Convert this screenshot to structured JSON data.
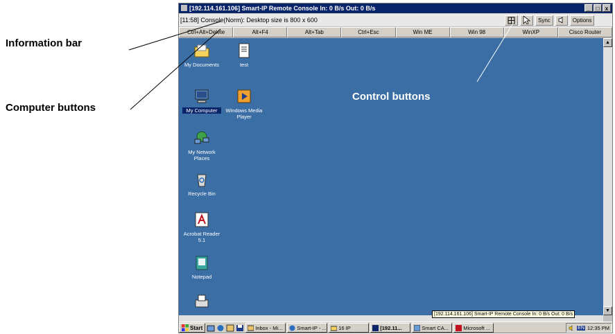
{
  "callouts": {
    "information_bar": "Information bar",
    "computer_buttons": "Computer buttons",
    "control_buttons": "Control buttons"
  },
  "window": {
    "title": "[192.114.161.106] Smart-IP Remote Console In: 0 B/s Out: 0 B/s",
    "min": "_",
    "max": "□",
    "close": "x"
  },
  "info_bar": {
    "text": "[11:58] Console(Norm): Desktop size is 800 x 600",
    "controls": {
      "sync": "Sync",
      "options": "Options"
    }
  },
  "computer_buttons": [
    "Ctrl+Alt+Delete",
    "Alt+F4",
    "Alt+Tab",
    "Ctrl+Esc",
    "Win ME",
    "Win 98",
    "WinXP",
    "Cisco Router"
  ],
  "desktop_icons": [
    {
      "label": "My Documents",
      "icon": "folder-icon"
    },
    {
      "label": "test",
      "icon": "document-icon"
    },
    {
      "label": "My Computer",
      "icon": "computer-icon"
    },
    {
      "label": "Windows Media Player",
      "icon": "media-player-icon"
    },
    {
      "label": "My Network Places",
      "icon": "network-icon"
    },
    {
      "label": "Recycle Bin",
      "icon": "recycle-bin-icon"
    },
    {
      "label": "Acrobat Reader 5.1",
      "icon": "acrobat-icon"
    },
    {
      "label": "Notepad",
      "icon": "notepad-icon"
    }
  ],
  "tooltip": "[192.114.161.106] Smart-IP Remote Console In: 0 B/s Out: 0 B/s",
  "taskbar": {
    "start": "Start",
    "tasks": [
      "Inbox - Mi...",
      "Smart-IP - ...",
      "16 IP",
      "[192.11...",
      "Smart CA...",
      "Microsoft ..."
    ],
    "language": "EN",
    "clock": "12:35 PM"
  },
  "colors": {
    "desktop": "#3a6ea5",
    "titlebar": "#0a246a",
    "chrome": "#d4d0c8"
  }
}
